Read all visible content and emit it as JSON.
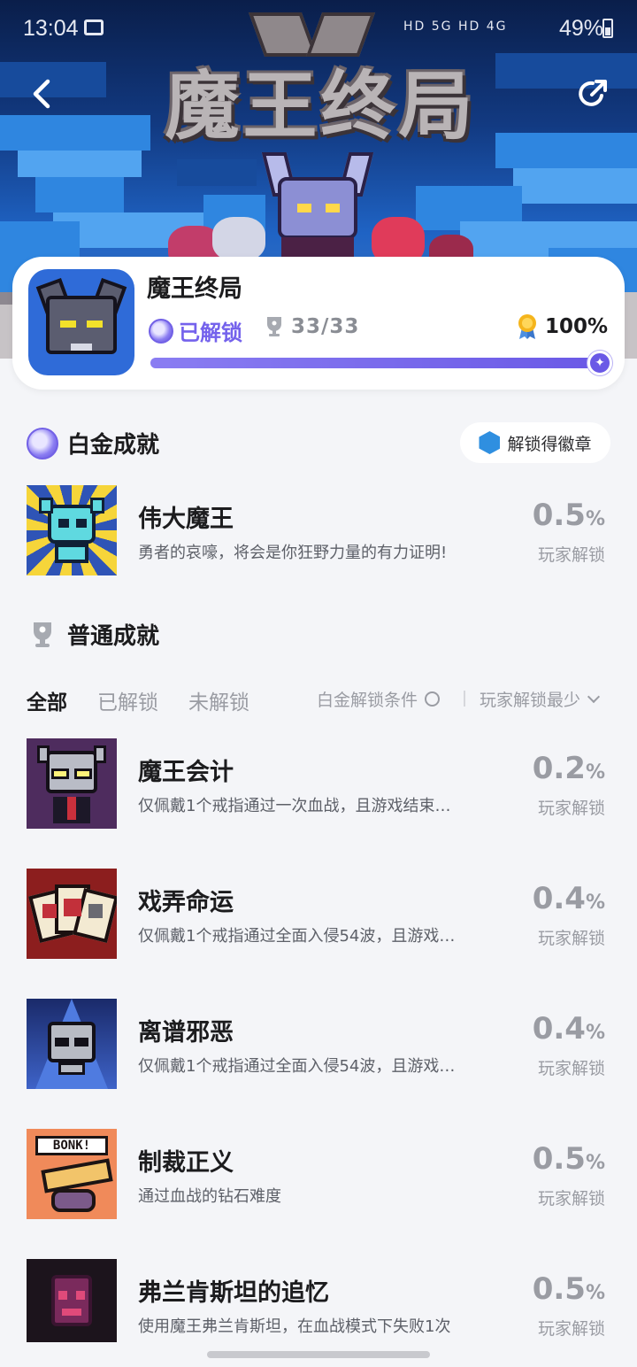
{
  "status_bar": {
    "time": "13:04",
    "network": "HD 5G HD 4G",
    "battery": "49%"
  },
  "header": {
    "logo_text": "魔王终局"
  },
  "game": {
    "title": "魔王终局",
    "unlock_label": "已解锁",
    "trophy_count": "33/33",
    "completion": "100%",
    "progress_fraction": 1.0
  },
  "platinum_section": {
    "title": "白金成就",
    "badge_button_label": "解锁得徽章",
    "achievement": {
      "name": "伟大魔王",
      "desc": "勇者的哀嚎，将会是你狂野力量的有力证明!",
      "percent": "0.5",
      "percent_sign": "%",
      "sub": "玩家解锁"
    }
  },
  "normal_section": {
    "title": "普通成就",
    "filters": {
      "tabs": [
        "全部",
        "已解锁",
        "未解锁"
      ],
      "active_index": 0,
      "platinum_condition": "白金解锁条件",
      "sort": "玩家解锁最少"
    },
    "achievements": [
      {
        "name": "魔王会计",
        "desc": "仅佩戴1个戒指通过一次血战，且游戏结束…",
        "percent": "0.2",
        "percent_sign": "%",
        "sub": "玩家解锁"
      },
      {
        "name": "戏弄命运",
        "desc": "仅佩戴1个戒指通过全面入侵54波，且游戏…",
        "percent": "0.4",
        "percent_sign": "%",
        "sub": "玩家解锁"
      },
      {
        "name": "离谱邪恶",
        "desc": "仅佩戴1个戒指通过全面入侵54波，且游戏…",
        "percent": "0.4",
        "percent_sign": "%",
        "sub": "玩家解锁"
      },
      {
        "name": "制裁正义",
        "desc": "通过血战的钻石难度",
        "percent": "0.5",
        "percent_sign": "%",
        "sub": "玩家解锁"
      },
      {
        "name": "弗兰肯斯坦的追忆",
        "desc": "使用魔王弗兰肯斯坦，在血战模式下失败1次",
        "percent": "0.5",
        "percent_sign": "%",
        "sub": "玩家解锁"
      }
    ]
  },
  "icon_art": {
    "bonk_text": "BONK!"
  },
  "colors": {
    "accent": "#6a59e6",
    "unlock_text": "#7462ec",
    "muted": "#9a9ca3",
    "page_bg": "#f4f5f8"
  }
}
